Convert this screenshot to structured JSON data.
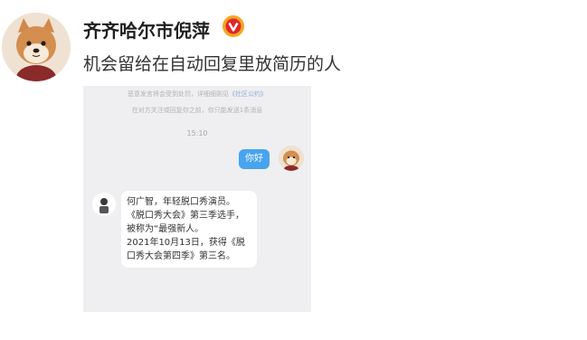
{
  "post": {
    "author_name": "齐齐哈尔市倪萍",
    "verified_icon": "verified-badge-icon",
    "text": "机会留给在自动回复里放简历的人"
  },
  "screenshot": {
    "notice_1_prefix": "恶意发言将会受到处罚，详细细则见",
    "notice_1_link": "《社区公约》",
    "notice_2": "在对方关注或回复你之前，你只能发送1条消息",
    "time": "15:10",
    "outgoing_message": "你好",
    "reply_lines": [
      "何广智，年轻脱口秀演员。",
      "《脱口秀大会》第三季选手，",
      "被称为“最强新人。",
      "2021年10月13日，获得《脱",
      "口秀大会第四季》第三名。"
    ]
  },
  "colors": {
    "bubble_blue": "#48a4ee",
    "chat_bg": "#efeff1",
    "verified_orange": "#f5a623"
  }
}
